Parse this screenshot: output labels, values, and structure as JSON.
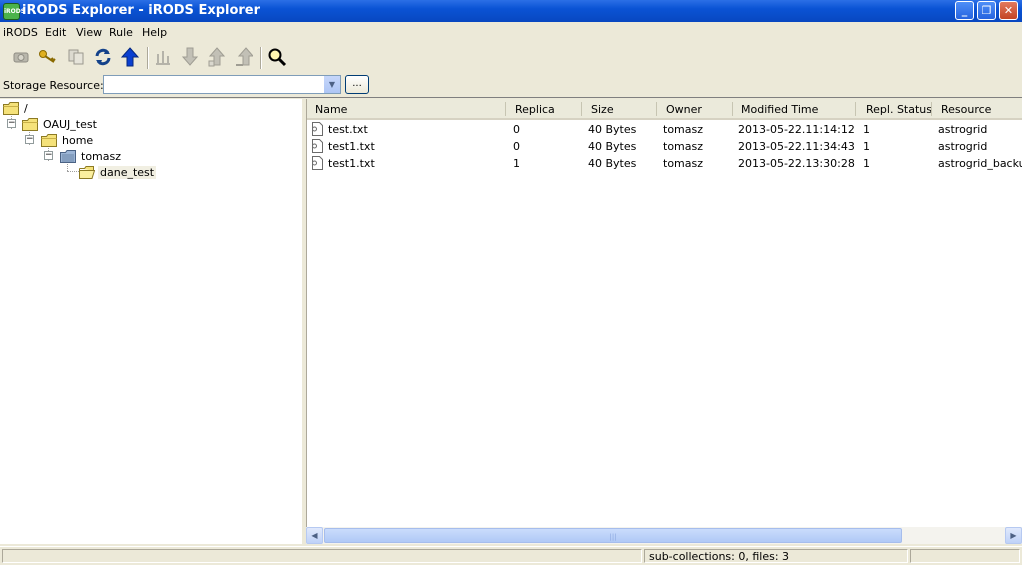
{
  "window": {
    "title": "iRODS Explorer - iRODS Explorer",
    "app_icon_text": "iRODS",
    "min_glyph": "_",
    "max_glyph": "❐",
    "close_glyph": "✕"
  },
  "menu": [
    "iRODS",
    "Edit",
    "View",
    "Rule",
    "Help"
  ],
  "toolbar": {
    "icons": [
      "disconnect-icon",
      "key-icon",
      "copy-icon",
      "refresh-icon",
      "up-arrow-icon",
      "replicate-icon",
      "download-icon",
      "upload-icon",
      "upload-alt-icon",
      "search-icon"
    ]
  },
  "storage": {
    "label": "Storage Resource:",
    "value": "",
    "browse_label": "..."
  },
  "tree": {
    "nodes": [
      {
        "label": "/",
        "level": 0,
        "expander": ""
      },
      {
        "label": "OAUJ_test",
        "level": 1,
        "expander": "−"
      },
      {
        "label": "home",
        "level": 2,
        "expander": "−"
      },
      {
        "label": "tomasz",
        "level": 3,
        "expander": "−"
      },
      {
        "label": "dane_test",
        "level": 4,
        "expander": ""
      }
    ]
  },
  "list": {
    "columns": [
      "Name",
      "Replica",
      "Size",
      "Owner",
      "Modified Time",
      "Repl. Status",
      "Resource"
    ],
    "rows": [
      [
        "test.txt",
        "0",
        "40 Bytes",
        "tomasz",
        "2013-05-22.11:14:12",
        "1",
        "astrogrid"
      ],
      [
        "test1.txt",
        "0",
        "40 Bytes",
        "tomasz",
        "2013-05-22.11:34:43",
        "1",
        "astrogrid"
      ],
      [
        "test1.txt",
        "1",
        "40 Bytes",
        "tomasz",
        "2013-05-22.13:30:28",
        "1",
        "astrogrid_backup"
      ]
    ]
  },
  "scroll": {
    "left_glyph": "◀",
    "right_glyph": "▶",
    "grip": "|||"
  },
  "status": {
    "text": "sub-collections: 0, files: 3"
  }
}
